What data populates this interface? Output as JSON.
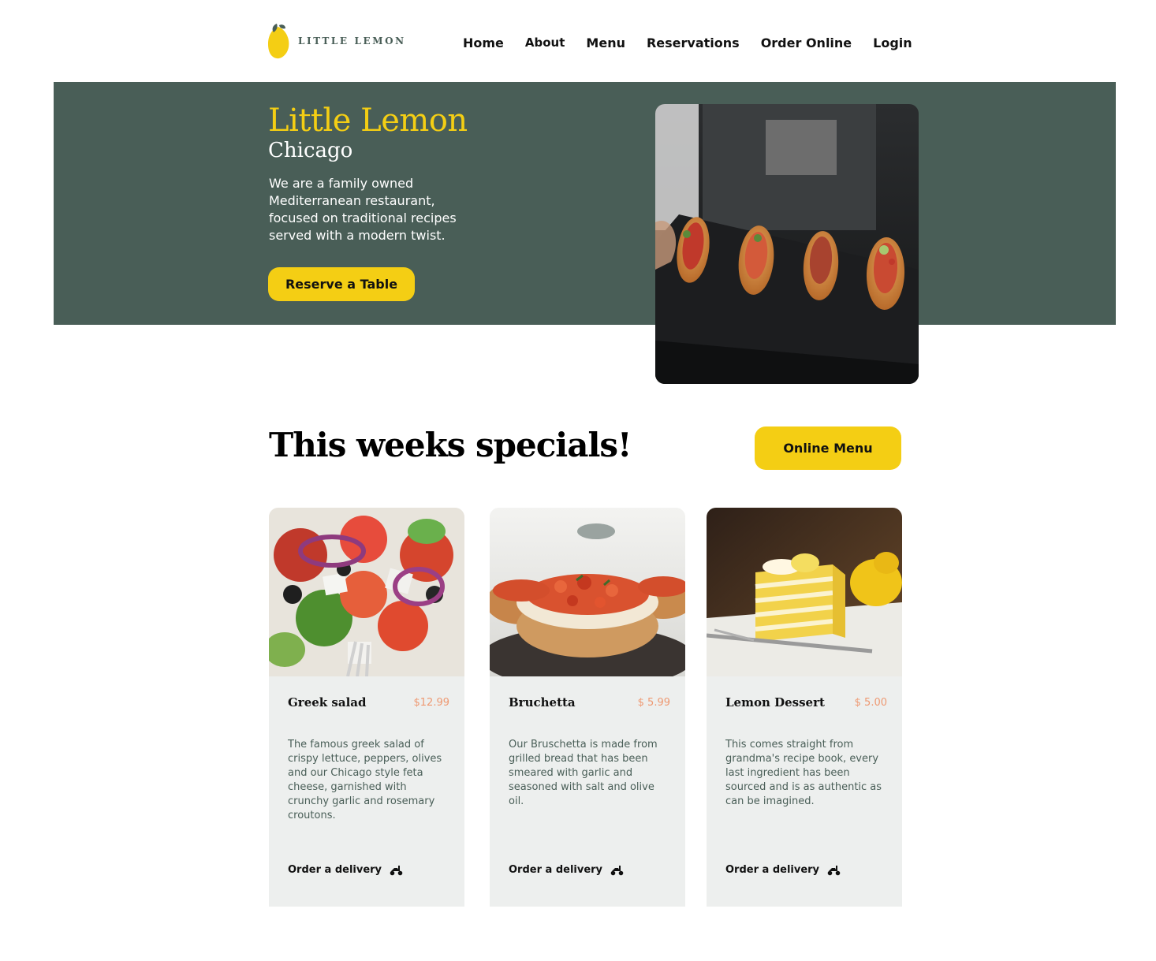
{
  "brand": {
    "name": "LITTLE LEMON"
  },
  "nav": {
    "items": [
      {
        "label": "Home"
      },
      {
        "label": "About"
      },
      {
        "label": "Menu"
      },
      {
        "label": "Reservations"
      },
      {
        "label": "Order Online"
      },
      {
        "label": "Login"
      }
    ]
  },
  "hero": {
    "title": "Little Lemon",
    "subtitle": "Chicago",
    "description": "We are a family owned Mediterranean restaurant, focused on traditional recipes served with a modern twist.",
    "cta_label": "Reserve a Table",
    "image": "serving-tray-photo"
  },
  "specials": {
    "title": "This weeks specials!",
    "menu_button_label": "Online Menu",
    "items": [
      {
        "name": "Greek salad",
        "price": "$12.99",
        "description": "The famous greek salad of crispy lettuce, peppers, olives and our Chicago style feta cheese, garnished with crunchy garlic and rosemary croutons.",
        "order_label": "Order a delivery",
        "image": "greek-salad-photo"
      },
      {
        "name": "Bruchetta",
        "price": "$ 5.99",
        "description": "Our Bruschetta is made from grilled bread that has been smeared with garlic and seasoned with salt and olive oil.",
        "order_label": "Order a delivery",
        "image": "bruschetta-photo"
      },
      {
        "name": "Lemon Dessert",
        "price": "$ 5.00",
        "description": "This comes straight from grandma's recipe book, every last ingredient has been sourced and is as authentic as can be imagined.",
        "order_label": "Order a delivery",
        "image": "lemon-dessert-photo"
      }
    ]
  },
  "colors": {
    "primary_green": "#495e57",
    "primary_yellow": "#f4ce14",
    "accent_salmon": "#ee9972",
    "card_bg": "#edefee"
  }
}
